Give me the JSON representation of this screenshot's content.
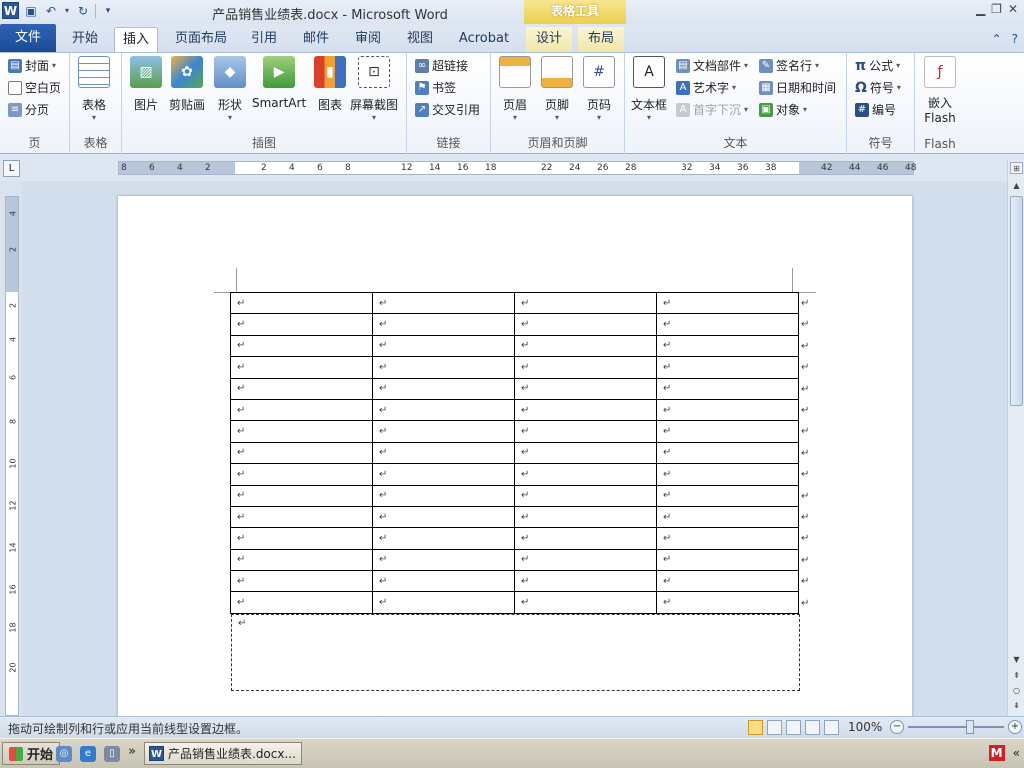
{
  "window": {
    "title": "产品销售业绩表.docx - Microsoft Word",
    "context_tool": "表格工具",
    "app_icon_letter": "W"
  },
  "tabs": [
    {
      "label": "文件"
    },
    {
      "label": "开始"
    },
    {
      "label": "插入"
    },
    {
      "label": "页面布局"
    },
    {
      "label": "引用"
    },
    {
      "label": "邮件"
    },
    {
      "label": "审阅"
    },
    {
      "label": "视图"
    },
    {
      "label": "Acrobat"
    },
    {
      "label": "设计"
    },
    {
      "label": "布局"
    }
  ],
  "ribbon": {
    "pages": {
      "label": "页",
      "items": [
        "封面",
        "空白页",
        "分页"
      ]
    },
    "tables": {
      "label": "表格",
      "button": "表格"
    },
    "illustrations": {
      "label": "插图",
      "buttons": [
        "图片",
        "剪贴画",
        "形状",
        "SmartArt",
        "图表",
        "屏幕截图"
      ]
    },
    "links": {
      "label": "链接",
      "items": [
        "超链接",
        "书签",
        "交叉引用"
      ]
    },
    "header_footer": {
      "label": "页眉和页脚",
      "buttons": [
        "页眉",
        "页脚",
        "页码"
      ]
    },
    "text": {
      "label": "文本",
      "textbox": "文本框",
      "items": [
        "文档部件",
        "艺术字",
        "首字下沉",
        "签名行",
        "日期和时间",
        "对象"
      ]
    },
    "symbols": {
      "label": "符号",
      "items": [
        "公式",
        "符号",
        "编号"
      ]
    },
    "flash": {
      "label": "Flash",
      "button_line1": "嵌入",
      "button_line2": "Flash"
    }
  },
  "ruler": {
    "h_ticks": [
      "8",
      "6",
      "4",
      "2",
      "2",
      "4",
      "6",
      "8",
      "12",
      "14",
      "16",
      "18",
      "22",
      "24",
      "26",
      "28",
      "32",
      "34",
      "36",
      "38",
      "42",
      "44",
      "46",
      "48"
    ],
    "v_ticks": [
      "4",
      "2",
      "2",
      "4",
      "6",
      "8",
      "10",
      "12",
      "14",
      "16",
      "18",
      "20"
    ]
  },
  "document": {
    "paragraph_mark": "↵",
    "table": {
      "rows": 15,
      "cols": 4
    }
  },
  "status": {
    "hint": "拖动可绘制列和行或应用当前线型设置边框。",
    "zoom": "100%",
    "zoom_minus": "−",
    "zoom_plus": "+"
  },
  "taskbar": {
    "start": "开始",
    "task": "产品销售业绩表.docx...",
    "more": "»",
    "tray_m": "M",
    "tray_chev": "«"
  },
  "colors": {
    "file_tab": "#2b5fad",
    "table_tools": "#eccf4c",
    "accent": "#2b5797"
  }
}
